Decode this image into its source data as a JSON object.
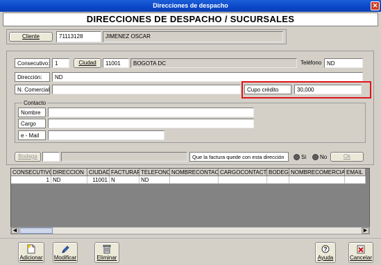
{
  "window": {
    "title": "Direcciones de despacho",
    "close_glyph": "✕"
  },
  "header": {
    "title": "DIRECCIONES DE DESPACHO / SUCURSALES"
  },
  "cliente": {
    "button": "Cliente",
    "id": "71113128",
    "name": "JIMENEZ OSCAR"
  },
  "form": {
    "consecutivo_label": "Consecutivo:",
    "consecutivo_value": "1",
    "ciudad_button": "Ciudad",
    "ciudad_code": "11001",
    "ciudad_name": "BOGOTA DC",
    "telefono_label": "Teléfono",
    "telefono_value": "ND",
    "direccion_label": "Dirección:",
    "direccion_value": "ND",
    "ncomercial_label": "N. Comercial",
    "ncomercial_value": "",
    "cupo_label": "Cupo crédito",
    "cupo_value": "30,000"
  },
  "contacto": {
    "legend": "Contacto",
    "nombre_label": "Nombre",
    "cargo_label": "Cargo",
    "email_label": "e - Mail",
    "nombre_value": "",
    "cargo_value": "",
    "email_value": ""
  },
  "bodega": {
    "button": "Bodega",
    "question": "Que la factura quede con esta dirección",
    "si_label": "Si",
    "no_label": "No",
    "ok_button": "Ok"
  },
  "grid": {
    "columns": [
      "CONSECUTIVO",
      "DIRECCION",
      "CIUDAD",
      "FACTURAR",
      "TELEFONO",
      "NOMBRECONTACT",
      "CARGOCONTACTO",
      "BODEGA",
      "NOMBRECOMERCIAL",
      "EMAIL"
    ],
    "rows": [
      [
        "1",
        "ND",
        "11001",
        "N",
        "ND",
        "",
        "",
        "",
        "",
        ""
      ]
    ]
  },
  "toolbar": {
    "add_label": "Adicionar",
    "edit_label": "Modificar",
    "delete_label": "Eliminar",
    "help_label": "Ayuda",
    "cancel_label": "Cancelar",
    "add_icon": "document-add-icon",
    "edit_icon": "pencil-icon",
    "delete_icon": "trash-icon",
    "help_icon": "help-icon",
    "cancel_icon": "cancel-icon"
  },
  "colors": {
    "titlebar": "#0a47c9",
    "highlight": "#e0141a",
    "face": "#d4d0c8"
  }
}
